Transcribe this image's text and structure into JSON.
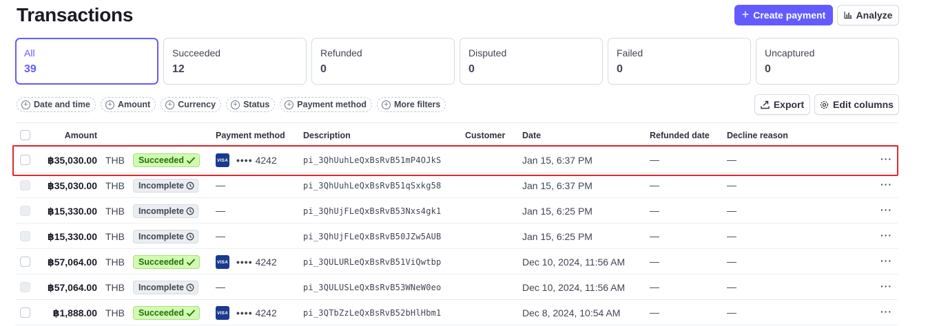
{
  "page": {
    "title": "Transactions"
  },
  "toolbar": {
    "create_payment_label": "Create payment",
    "analyze_label": "Analyze",
    "export_label": "Export",
    "edit_columns_label": "Edit columns"
  },
  "tabs": [
    {
      "label": "All",
      "count": "39",
      "active": true
    },
    {
      "label": "Succeeded",
      "count": "12"
    },
    {
      "label": "Refunded",
      "count": "0"
    },
    {
      "label": "Disputed",
      "count": "0"
    },
    {
      "label": "Failed",
      "count": "0"
    },
    {
      "label": "Uncaptured",
      "count": "0"
    }
  ],
  "filters": [
    "Date and time",
    "Amount",
    "Currency",
    "Status",
    "Payment method",
    "More filters"
  ],
  "columns": {
    "amount": "Amount",
    "payment_method": "Payment method",
    "description": "Description",
    "customer": "Customer",
    "date": "Date",
    "refunded_date": "Refunded date",
    "decline_reason": "Decline reason"
  },
  "rows": [
    {
      "amount": "฿35,030.00",
      "currency": "THB",
      "status": "Succeeded",
      "card_brand": "VISA",
      "card_dots": "••••",
      "card_last4": "4242",
      "pm_empty": "",
      "description": "pi_3QhUuhLeQxBsRvB51mP4OJkS",
      "date": "Jan 15, 6:37 PM",
      "refunded_date": "—",
      "decline_reason": "—",
      "more": "···"
    },
    {
      "amount": "฿35,030.00",
      "currency": "THB",
      "status": "Incomplete",
      "card_brand": "",
      "card_dots": "",
      "card_last4": "",
      "pm_empty": "—",
      "description": "pi_3QhUuhLeQxBsRvB51qSxkg58",
      "date": "Jan 15, 6:37 PM",
      "refunded_date": "—",
      "decline_reason": "—",
      "more": "···"
    },
    {
      "amount": "฿15,330.00",
      "currency": "THB",
      "status": "Incomplete",
      "card_brand": "",
      "card_dots": "",
      "card_last4": "",
      "pm_empty": "—",
      "description": "pi_3QhUjFLeQxBsRvB53Nxs4gk1",
      "date": "Jan 15, 6:25 PM",
      "refunded_date": "—",
      "decline_reason": "—",
      "more": "···"
    },
    {
      "amount": "฿15,330.00",
      "currency": "THB",
      "status": "Incomplete",
      "card_brand": "",
      "card_dots": "",
      "card_last4": "",
      "pm_empty": "—",
      "description": "pi_3QhUjFLeQxBsRvB50JZw5AUB",
      "date": "Jan 15, 6:25 PM",
      "refunded_date": "—",
      "decline_reason": "—",
      "more": "···"
    },
    {
      "amount": "฿57,064.00",
      "currency": "THB",
      "status": "Succeeded",
      "card_brand": "VISA",
      "card_dots": "••••",
      "card_last4": "4242",
      "pm_empty": "",
      "description": "pi_3QULURLeQxBsRvB51ViQwtbp",
      "date": "Dec 10, 2024, 11:56 AM",
      "refunded_date": "—",
      "decline_reason": "—",
      "more": "···"
    },
    {
      "amount": "฿57,064.00",
      "currency": "THB",
      "status": "Incomplete",
      "card_brand": "",
      "card_dots": "",
      "card_last4": "",
      "pm_empty": "—",
      "description": "pi_3QULUSLeQxBsRvB53WNeW0eo",
      "date": "Dec 10, 2024, 11:56 AM",
      "refunded_date": "—",
      "decline_reason": "—",
      "more": "···"
    },
    {
      "amount": "฿1,888.00",
      "currency": "THB",
      "status": "Succeeded",
      "card_brand": "VISA",
      "card_dots": "••••",
      "card_last4": "4242",
      "pm_empty": "",
      "description": "pi_3QTbZzLeQxBsRvB52bHlHbm1",
      "date": "Dec 8, 2024, 10:54 AM",
      "refunded_date": "—",
      "decline_reason": "—",
      "more": "···"
    }
  ],
  "colors": {
    "accent": "#635bff",
    "succeeded_bg": "#d1fab3",
    "succeeded_text": "#217005",
    "incomplete_bg": "#ebeef1",
    "highlight": "#e5262a"
  },
  "icons": {
    "create_payment": "plus-icon",
    "analyze": "bar-chart-icon",
    "export": "export-icon",
    "edit_columns": "gear-icon",
    "filter": "plus-circle-icon",
    "succeeded": "checkmark-icon",
    "incomplete": "clock-icon",
    "card": "visa-icon",
    "row_actions": "more-icon"
  }
}
